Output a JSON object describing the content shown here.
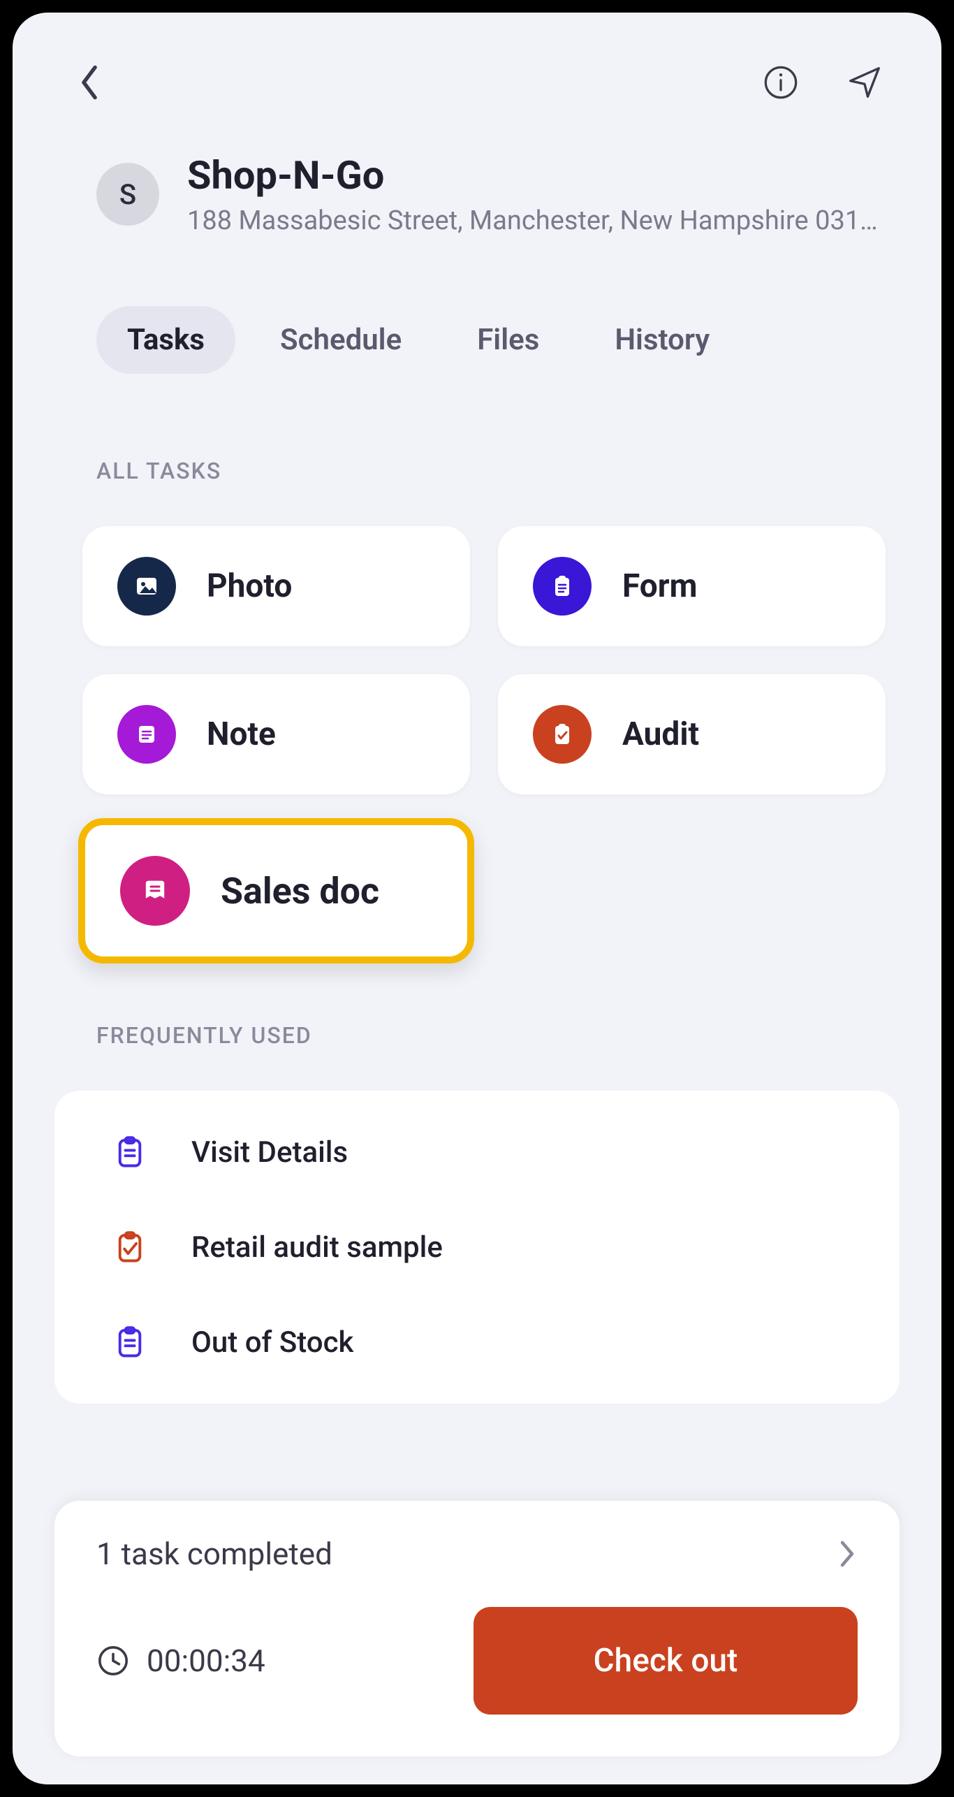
{
  "store": {
    "avatarLetter": "S",
    "name": "Shop-N-Go",
    "address": "188 Massabesic Street, Manchester, New Hampshire 0310…"
  },
  "tabs": [
    {
      "label": "Tasks",
      "active": true
    },
    {
      "label": "Schedule",
      "active": false
    },
    {
      "label": "Files",
      "active": false
    },
    {
      "label": "History",
      "active": false
    }
  ],
  "sections": {
    "allTasks": "ALL TASKS",
    "frequentlyUsed": "FREQUENTLY USED"
  },
  "tasks": [
    {
      "label": "Photo",
      "icon": "photo-icon",
      "color": "#16284a"
    },
    {
      "label": "Form",
      "icon": "form-icon",
      "color": "#3a17d6"
    },
    {
      "label": "Note",
      "icon": "note-icon",
      "color": "#a51ad6"
    },
    {
      "label": "Audit",
      "icon": "audit-icon",
      "color": "#c9411f"
    },
    {
      "label": "Sales doc",
      "icon": "salesdoc-icon",
      "color": "#d01f82",
      "highlighted": true
    }
  ],
  "frequent": [
    {
      "label": "Visit Details",
      "icon": "form-outline-icon",
      "color": "#4a2ae6"
    },
    {
      "label": "Retail audit sample",
      "icon": "audit-outline-icon",
      "color": "#c9411f"
    },
    {
      "label": "Out of Stock",
      "icon": "form-outline-icon",
      "color": "#4a2ae6"
    }
  ],
  "footer": {
    "completedText": "1 task completed",
    "timer": "00:00:34",
    "checkoutLabel": "Check out"
  }
}
